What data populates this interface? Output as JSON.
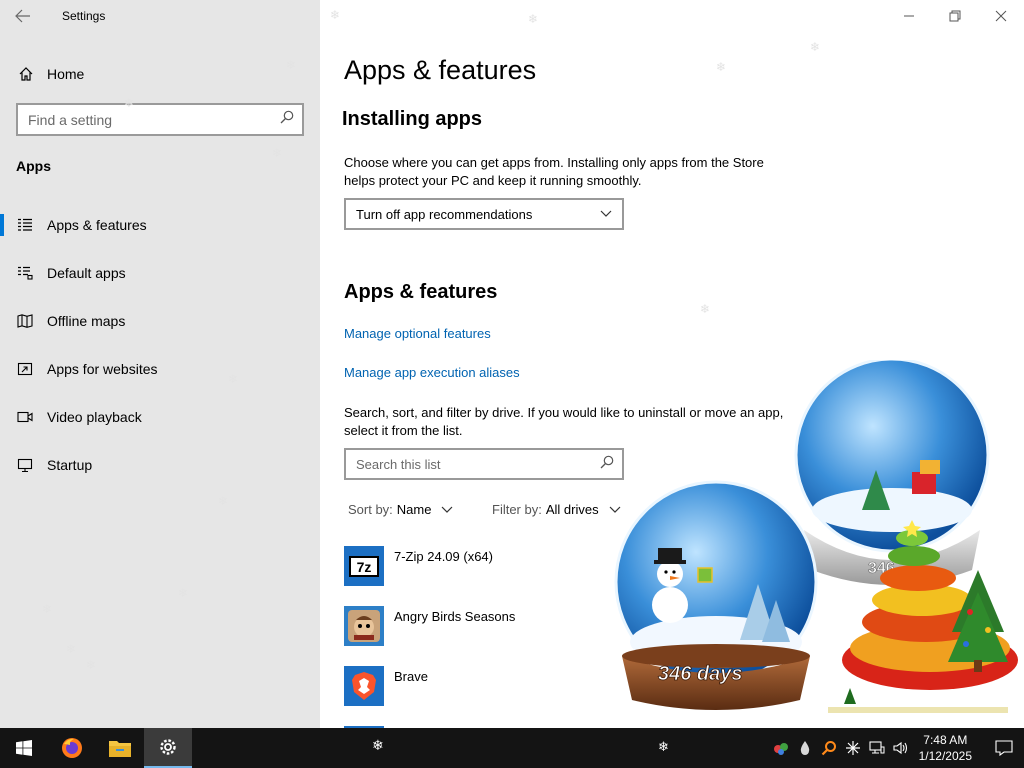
{
  "window": {
    "title": "Settings"
  },
  "sidebar": {
    "home_label": "Home",
    "search_placeholder": "Find a setting",
    "section_label": "Apps",
    "items": [
      {
        "label": "Apps & features",
        "icon": "apps-features-icon",
        "active": true
      },
      {
        "label": "Default apps",
        "icon": "default-apps-icon"
      },
      {
        "label": "Offline maps",
        "icon": "offline-maps-icon"
      },
      {
        "label": "Apps for websites",
        "icon": "apps-websites-icon"
      },
      {
        "label": "Video playback",
        "icon": "video-playback-icon"
      },
      {
        "label": "Startup",
        "icon": "startup-icon"
      }
    ]
  },
  "main": {
    "page_title": "Apps & features",
    "installing": {
      "heading": "Installing apps",
      "description": "Choose where you can get apps from. Installing only apps from the Store helps protect your PC and keep it running smoothly.",
      "dropdown_value": "Turn off app recommendations"
    },
    "features": {
      "heading": "Apps & features",
      "link_optional": "Manage optional features",
      "link_aliases": "Manage app execution aliases",
      "description": "Search, sort, and filter by drive. If you would like to uninstall or move an app, select it from the list.",
      "search_placeholder": "Search this list",
      "sort_label": "Sort by:",
      "sort_value": "Name",
      "filter_label": "Filter by:",
      "filter_value": "All drives"
    },
    "apps": [
      {
        "name": "7-Zip 24.09 (x64)",
        "icon": "7zip-icon",
        "icon_text": "7z"
      },
      {
        "name": "Angry Birds Seasons",
        "icon": "angry-birds-icon"
      },
      {
        "name": "Brave",
        "icon": "brave-icon"
      }
    ]
  },
  "widget": {
    "counter_text": "346 days",
    "counter_back": "346"
  },
  "taskbar": {
    "time": "7:48 AM",
    "date": "1/12/2025",
    "pinned": [
      "start-icon",
      "firefox-icon",
      "file-explorer-icon",
      "settings-icon"
    ]
  },
  "colors": {
    "accent": "#0078d7",
    "link": "#0063b1",
    "sidebar_bg": "#e6e6e6",
    "taskbar_bg": "#141414"
  }
}
